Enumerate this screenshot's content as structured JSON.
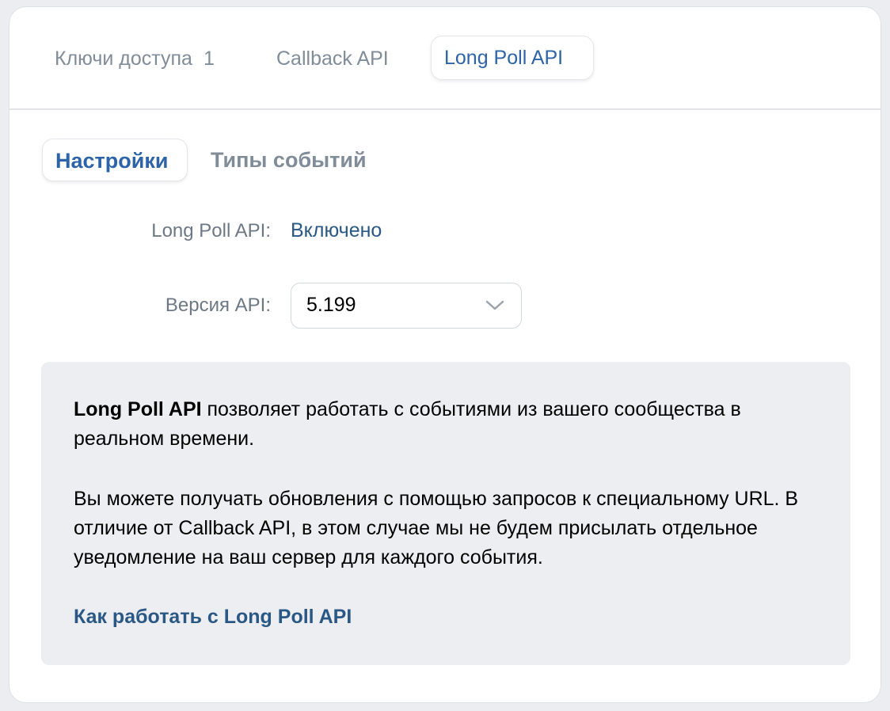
{
  "tabs": {
    "access_keys": {
      "label": "Ключи доступа",
      "count": "1"
    },
    "callback": {
      "label": "Callback API"
    },
    "long_poll": {
      "label": "Long Poll API"
    }
  },
  "subtabs": {
    "settings": "Настройки",
    "event_types": "Типы событий"
  },
  "settings": {
    "status_label": "Long Poll API:",
    "status_value": "Включено",
    "version_label": "Версия API:",
    "version_value": "5.199"
  },
  "info": {
    "para1_bold": "Long Poll API",
    "para1_rest": " позволяет работать с событиями из вашего сообщества в реальном времени.",
    "para2": "Вы можете получать обновления с помощью запросов к специальному URL. В отличие от Callback API, в этом случае мы не будем присылать отдельное уведомление на ваш сервер для каждого события.",
    "link": "Как работать с Long Poll API"
  }
}
